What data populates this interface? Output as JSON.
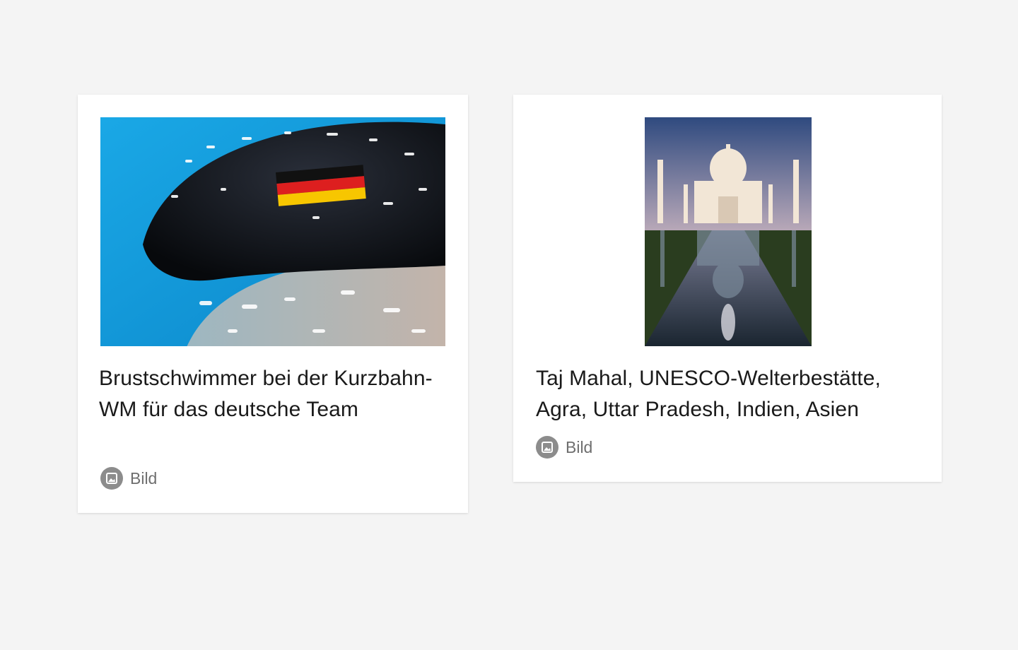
{
  "cards": [
    {
      "title": "Brustschwimmer bei der Kurzbahn-WM für das deutsche Team",
      "type_label": "Bild",
      "image_icon": "image-icon"
    },
    {
      "title": "Taj Mahal, UNESCO-Welterbestätte, Agra, Uttar Pradesh, Indien, Asien",
      "type_label": "Bild",
      "image_icon": "image-icon"
    }
  ],
  "colors": {
    "page_background": "#f4f4f4",
    "card_background": "#ffffff",
    "title_text": "#1a1a1a",
    "meta_text": "#6f6f6f",
    "meta_icon": "#8c8c8c"
  }
}
